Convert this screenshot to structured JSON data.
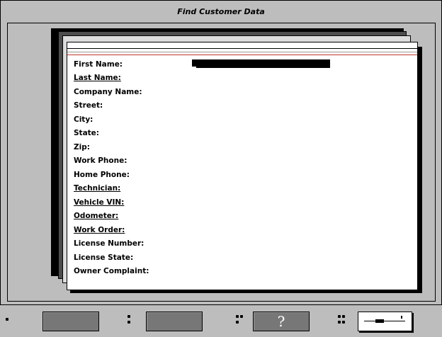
{
  "window": {
    "title": "Find Customer Data"
  },
  "form": {
    "fields": [
      {
        "label": "First Name:",
        "underlined": false
      },
      {
        "label": "Last Name:",
        "underlined": true
      },
      {
        "label": "Company Name:",
        "underlined": false
      },
      {
        "label": "Street:",
        "underlined": false
      },
      {
        "label": "City:",
        "underlined": false
      },
      {
        "label": "State:",
        "underlined": false
      },
      {
        "label": "Zip:",
        "underlined": false
      },
      {
        "label": "Work Phone:",
        "underlined": false
      },
      {
        "label": "Home Phone:",
        "underlined": false
      },
      {
        "label": "Technician:",
        "underlined": true
      },
      {
        "label": "Vehicle VIN:",
        "underlined": true
      },
      {
        "label": "Odometer:",
        "underlined": true
      },
      {
        "label": "Work Order:",
        "underlined": true
      },
      {
        "label": "License Number:",
        "underlined": false
      },
      {
        "label": "License State:",
        "underlined": false
      },
      {
        "label": "Owner Complaint:",
        "underlined": false
      }
    ],
    "first_name_value": ""
  },
  "toolbar": {
    "help_label": "?",
    "buttons": [
      {
        "name": "function-1-button",
        "dots": 1
      },
      {
        "name": "function-2-button",
        "dots": 2
      },
      {
        "name": "help-button",
        "dots": 3
      },
      {
        "name": "settings-button",
        "dots": 4
      }
    ]
  },
  "colors": {
    "background": "#bdbdbd",
    "button": "#777777",
    "accent_line": "#c0392b"
  }
}
